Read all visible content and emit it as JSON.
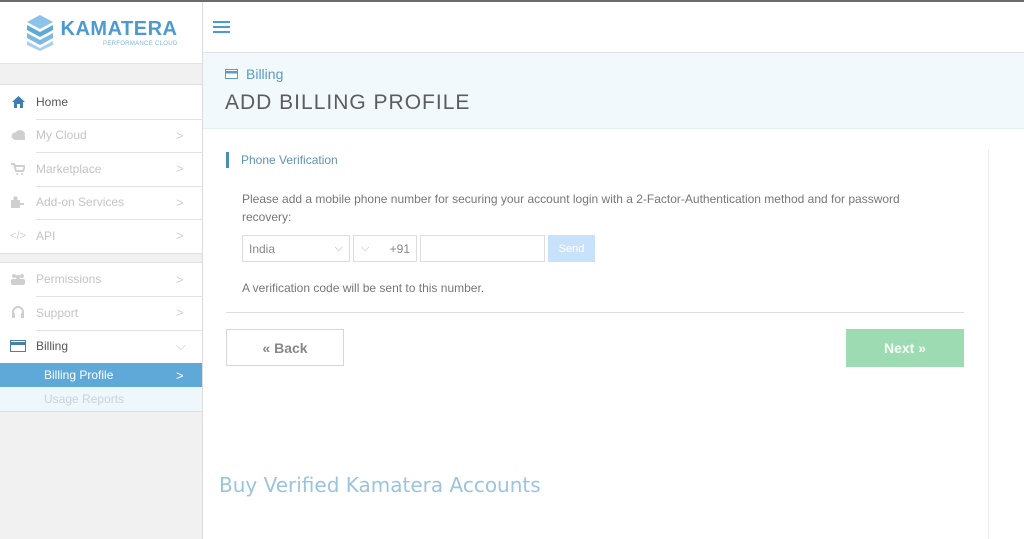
{
  "brand": {
    "name": "KAMATERA",
    "tagline": "PERFORMANCE CLOUD",
    "accent_color": "#4b9bd1"
  },
  "sidebar": {
    "group1": [
      {
        "label": "Home",
        "icon": "home-icon",
        "active": true,
        "chevron": ""
      },
      {
        "label": "My Cloud",
        "icon": "cloud-icon",
        "active": false,
        "chevron": ">"
      },
      {
        "label": "Marketplace",
        "icon": "cart-icon",
        "active": false,
        "chevron": ">"
      },
      {
        "label": "Add-on Services",
        "icon": "puzzle-icon",
        "active": false,
        "chevron": ">"
      },
      {
        "label": "API",
        "icon": "code-icon",
        "active": false,
        "chevron": ">"
      }
    ],
    "group2": [
      {
        "label": "Permissions",
        "icon": "users-icon",
        "active": false,
        "chevron": ">"
      },
      {
        "label": "Support",
        "icon": "headset-icon",
        "active": false,
        "chevron": ">"
      },
      {
        "label": "Billing",
        "icon": "credit-card-icon",
        "active": true,
        "chevron": "⌵"
      }
    ],
    "billing_sub": [
      {
        "label": "Billing Profile",
        "selected": true,
        "chevron": ">"
      },
      {
        "label": "Usage Reports",
        "selected": false
      }
    ]
  },
  "header": {
    "menu_icon": "hamburger-icon",
    "breadcrumb": "Billing",
    "page_title": "ADD BILLING PROFILE"
  },
  "form": {
    "section_title": "Phone Verification",
    "description": "Please add a mobile phone number for securing your account login with a 2-Factor-Authentication method and for password recovery:",
    "country_value": "India",
    "dial_code": "+91",
    "phone_value": "",
    "phone_placeholder": "",
    "send_label": "Send",
    "note": "A verification code will be sent to this number.",
    "back_label": "« Back",
    "next_label": "Next »",
    "next_color": "#9ddcb2",
    "send_color": "#c9e2fb"
  },
  "watermark": "Buy Verified Kamatera Accounts"
}
